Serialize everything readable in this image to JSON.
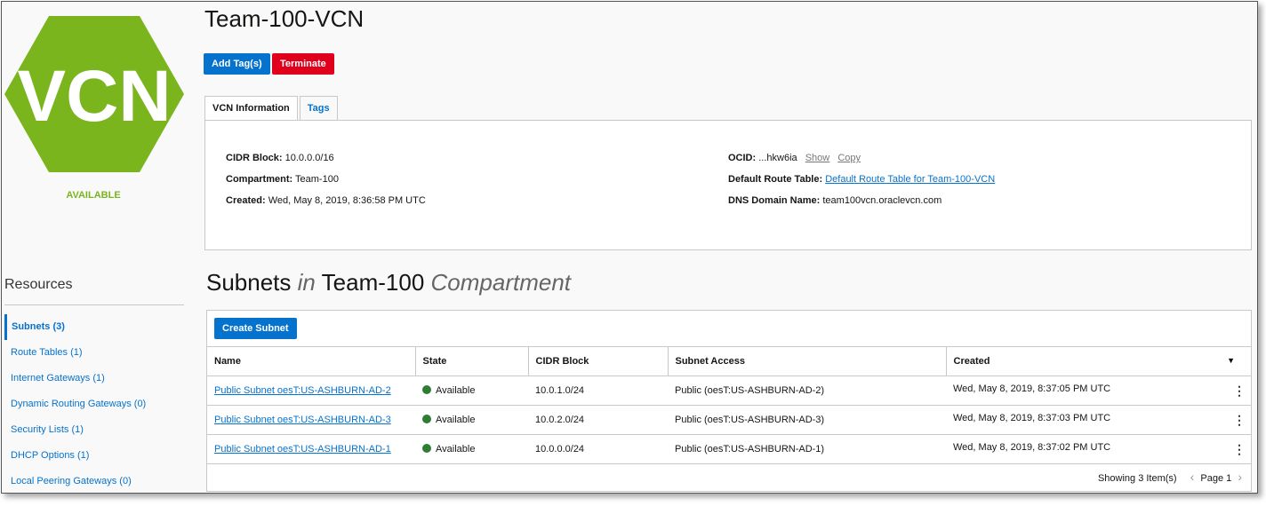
{
  "vcn": {
    "logo_text": "VCN",
    "status": "AVAILABLE",
    "logo_color": "#7ab51d"
  },
  "page": {
    "title": "Team-100-VCN",
    "add_tags_label": "Add Tag(s)",
    "terminate_label": "Terminate"
  },
  "tabs": [
    {
      "label": "VCN Information"
    },
    {
      "label": "Tags"
    }
  ],
  "info": {
    "cidr_label": "CIDR Block:",
    "cidr_value": "10.0.0.0/16",
    "compartment_label": "Compartment:",
    "compartment_value": "Team-100",
    "created_label": "Created:",
    "created_value": "Wed, May 8, 2019, 8:36:58 PM UTC",
    "ocid_label": "OCID:",
    "ocid_value": "...hkw6ia",
    "show_label": "Show",
    "copy_label": "Copy",
    "route_label": "Default Route Table:",
    "route_value": "Default Route Table for Team-100-VCN",
    "dns_label": "DNS Domain Name:",
    "dns_value": "team100vcn.oraclevcn.com"
  },
  "resources": {
    "title": "Resources",
    "items": [
      {
        "label": "Subnets (3)"
      },
      {
        "label": "Route Tables (1)"
      },
      {
        "label": "Internet Gateways (1)"
      },
      {
        "label": "Dynamic Routing Gateways (0)"
      },
      {
        "label": "Security Lists (1)"
      },
      {
        "label": "DHCP Options (1)"
      },
      {
        "label": "Local Peering Gateways (0)"
      }
    ]
  },
  "subnets": {
    "title_main": "Subnets",
    "title_in": "in",
    "title_compartment_name": "Team-100",
    "title_compartment": "Compartment",
    "create_label": "Create Subnet",
    "columns": [
      "Name",
      "State",
      "CIDR Block",
      "Subnet Access",
      "Created"
    ],
    "rows": [
      {
        "name": "Public Subnet oesT:US-ASHBURN-AD-2",
        "state": "Available",
        "cidr": "10.0.1.0/24",
        "access": "Public (oesT:US-ASHBURN-AD-2)",
        "created": "Wed, May 8, 2019, 8:37:05 PM UTC"
      },
      {
        "name": "Public Subnet oesT:US-ASHBURN-AD-3",
        "state": "Available",
        "cidr": "10.0.2.0/24",
        "access": "Public (oesT:US-ASHBURN-AD-3)",
        "created": "Wed, May 8, 2019, 8:37:03 PM UTC"
      },
      {
        "name": "Public Subnet oesT:US-ASHBURN-AD-1",
        "state": "Available",
        "cidr": "10.0.0.0/24",
        "access": "Public (oesT:US-ASHBURN-AD-1)",
        "created": "Wed, May 8, 2019, 8:37:02 PM UTC"
      }
    ],
    "showing": "Showing 3 Item(s)",
    "page": "Page 1"
  },
  "colors": {
    "primary": "#0572ce",
    "danger": "#e0001b",
    "available_dot": "#2e7d32"
  }
}
